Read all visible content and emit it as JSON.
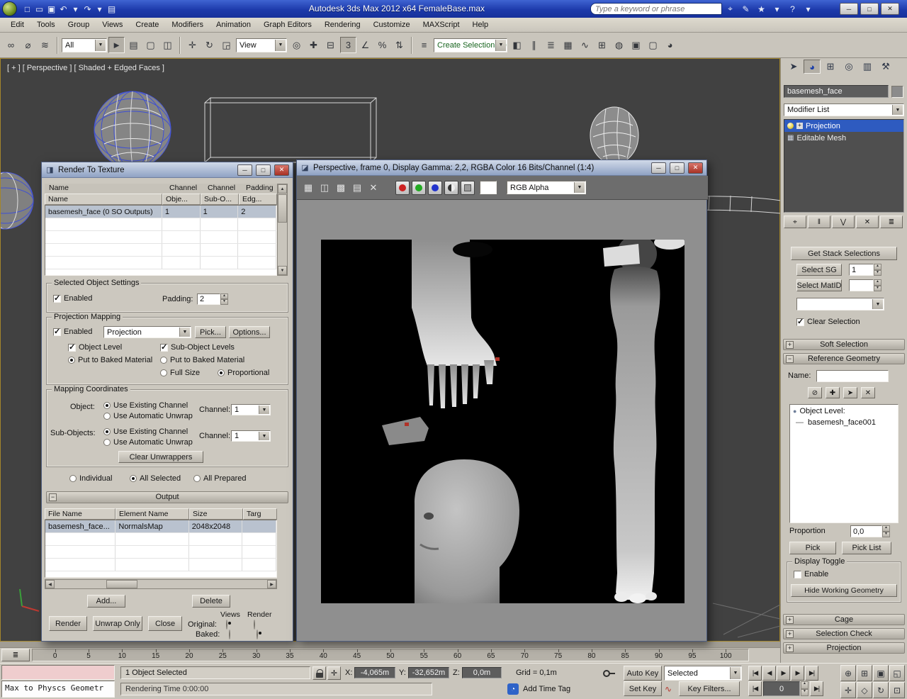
{
  "window_controls": {
    "minimize": "─",
    "maximize": "□",
    "close": "✕"
  },
  "titlebar": {
    "title": "Autodesk 3ds Max 2012 x64   FemaleBase.max",
    "search_placeholder": "Type a keyword or phrase",
    "qat_icons": [
      {
        "name": "new-file-icon",
        "glyph": "□"
      },
      {
        "name": "open-file-icon",
        "glyph": "▭"
      },
      {
        "name": "save-file-icon",
        "glyph": "▣"
      },
      {
        "name": "undo-icon",
        "glyph": "↶"
      },
      {
        "name": "undo-dropdown-icon",
        "glyph": "▾"
      },
      {
        "name": "redo-icon",
        "glyph": "↷"
      },
      {
        "name": "redo-dropdown-icon",
        "glyph": "▾"
      },
      {
        "name": "project-toolbar-icon",
        "glyph": "▤"
      }
    ],
    "infocenter_icons": [
      {
        "name": "search-icon",
        "glyph": "⌖"
      },
      {
        "name": "communication-center-icon",
        "glyph": "✎"
      },
      {
        "name": "favorites-icon",
        "glyph": "★"
      },
      {
        "name": "favorites-dropdown-icon",
        "glyph": "▾"
      },
      {
        "name": "help-icon",
        "glyph": "?"
      },
      {
        "name": "help-dropdown-icon",
        "glyph": "▾"
      }
    ]
  },
  "menu": {
    "items": [
      "Edit",
      "Tools",
      "Group",
      "Views",
      "Create",
      "Modifiers",
      "Animation",
      "Graph Editors",
      "Rendering",
      "Customize",
      "MAXScript",
      "Help"
    ]
  },
  "toolbar": {
    "selection_filter": "All",
    "coordinate_system": "View",
    "named_selection": "Create Selection Se",
    "group1": [
      {
        "name": "select-and-link-icon",
        "glyph": "∞"
      },
      {
        "name": "unlink-selection-icon",
        "glyph": "⌀"
      },
      {
        "name": "bind-to-space-warp-icon",
        "glyph": "≋"
      }
    ],
    "group2": [
      {
        "name": "select-object-icon",
        "glyph": "►"
      },
      {
        "name": "select-by-name-icon",
        "glyph": "▤"
      },
      {
        "name": "rectangular-selection-icon",
        "glyph": "▢"
      },
      {
        "name": "window-crossing-icon",
        "glyph": "◫"
      }
    ],
    "group3": [
      {
        "name": "select-and-move-icon",
        "glyph": "✛"
      },
      {
        "name": "select-and-rotate-icon",
        "glyph": "↻"
      },
      {
        "name": "select-and-scale-icon",
        "glyph": "◲"
      }
    ],
    "group4": [
      {
        "name": "use-center-icon",
        "glyph": "◎"
      },
      {
        "name": "select-and-manipulate-icon",
        "glyph": "✚"
      },
      {
        "name": "keyboard-override-icon",
        "glyph": "⊟"
      }
    ],
    "group5": [
      {
        "name": "snaps-toggle-icon",
        "glyph": "3"
      },
      {
        "name": "angle-snap-icon",
        "glyph": "∠"
      },
      {
        "name": "percent-snap-icon",
        "glyph": "%"
      },
      {
        "name": "spinner-snap-icon",
        "glyph": "⇅"
      }
    ],
    "group6": [
      {
        "name": "edit-named-selections-icon",
        "glyph": "≡"
      }
    ],
    "group7": [
      {
        "name": "mirror-icon",
        "glyph": "◧"
      },
      {
        "name": "align-icon",
        "glyph": "∥"
      },
      {
        "name": "layer-manager-icon",
        "glyph": "≣"
      },
      {
        "name": "ribbon-toggle-icon",
        "glyph": "▦"
      },
      {
        "name": "curve-editor-icon",
        "glyph": "∿"
      },
      {
        "name": "schematic-view-icon",
        "glyph": "⊞"
      },
      {
        "name": "material-editor-icon",
        "glyph": "◍"
      },
      {
        "name": "render-setup-icon",
        "glyph": "▣"
      },
      {
        "name": "rendered-frame-icon",
        "glyph": "▢"
      },
      {
        "name": "render-production-icon",
        "glyph": "◕"
      }
    ]
  },
  "viewport": {
    "label": "[ + ] [ Perspective ] [ Shaded + Edged Faces ]"
  },
  "rtt": {
    "title": "Render To Texture",
    "objects_table": {
      "header_row1": [
        "Name",
        "Channel",
        "Channel",
        "Padding"
      ],
      "header_row2": [
        "Name",
        "Obje...",
        "Sub-O...",
        "Edg..."
      ],
      "row_name": "basemesh_face (0 SO Outputs)",
      "row_values": [
        "1",
        "1",
        "2"
      ]
    },
    "sos": {
      "title": "Selected Object Settings",
      "enabled": "Enabled",
      "padding_label": "Padding:",
      "padding_value": "2"
    },
    "pm": {
      "title": "Projection Mapping",
      "enabled": "Enabled",
      "modifier": "Projection",
      "pick": "Pick...",
      "options": "Options...",
      "object_level": "Object Level",
      "sub_object_levels": "Sub-Object Levels",
      "put_baked_1": "Put to Baked Material",
      "put_baked_2": "Put to Baked Material",
      "full_size": "Full Size",
      "proportional": "Proportional"
    },
    "mc": {
      "title": "Mapping Coordinates",
      "object": "Object:",
      "sub_objects": "Sub-Objects:",
      "use_existing_1": "Use Existing Channel",
      "use_auto_1": "Use Automatic Unwrap",
      "use_existing_2": "Use Existing Channel",
      "use_auto_2": "Use Automatic Unwrap",
      "channel_label_1": "Channel:",
      "channel_value_1": "1",
      "channel_label_2": "Channel:",
      "channel_value_2": "1",
      "clear_unwrappers": "Clear Unwrappers"
    },
    "scope": {
      "individual": "Individual",
      "all_selected": "All Selected",
      "all_prepared": "All Prepared"
    },
    "output": {
      "title": "Output",
      "headers": [
        "File Name",
        "Element Name",
        "Size",
        "Targ"
      ],
      "row": [
        "basemesh_face...",
        "NormalsMap",
        "2048x2048"
      ],
      "add": "Add...",
      "delete": "Delete",
      "views": "Views",
      "render": "Render",
      "original": "Original:",
      "baked": "Baked:"
    },
    "buttons": {
      "render": "Render",
      "unwrap_only": "Unwrap Only",
      "close": "Close"
    }
  },
  "rfw": {
    "title": "Perspective, frame 0, Display Gamma: 2,2, RGBA Color 16 Bits/Channel (1:4)",
    "channel_value": "RGB Alpha",
    "toolbar_icons": [
      {
        "name": "save-image-icon",
        "glyph": "▦"
      },
      {
        "name": "clone-rendered-frame-icon",
        "glyph": "◫"
      },
      {
        "name": "enable-channels-icon",
        "glyph": "▩"
      },
      {
        "name": "print-image-icon",
        "glyph": "▤"
      },
      {
        "name": "clear-rendered-frame-icon",
        "glyph": "✕"
      }
    ]
  },
  "command_panel": {
    "tabs": [
      {
        "name": "tab-create",
        "glyph": "➤"
      },
      {
        "name": "tab-modify",
        "glyph": "◕"
      },
      {
        "name": "tab-hierarchy",
        "glyph": "⊞"
      },
      {
        "name": "tab-motion",
        "glyph": "◎"
      },
      {
        "name": "tab-display",
        "glyph": "▥"
      },
      {
        "name": "tab-utilities",
        "glyph": "⚒"
      }
    ],
    "object_name": "basemesh_face",
    "modifier_list_label": "Modifier List",
    "stack_item_1": "Projection",
    "stack_item_2": "Editable Mesh",
    "expand_glyph": "+",
    "mesh_glyph": "▦",
    "stack_tools": [
      {
        "name": "pin-stack-icon",
        "glyph": "⌖"
      },
      {
        "name": "show-end-result-icon",
        "glyph": "‖"
      },
      {
        "name": "make-unique-icon",
        "glyph": "⋁"
      },
      {
        "name": "remove-modifier-icon",
        "glyph": "✕"
      },
      {
        "name": "configure-modifier-sets-icon",
        "glyph": "≣"
      }
    ],
    "get_stack_selections": "Get Stack Selections",
    "select_sg": "Select SG",
    "select_sg_value": "1",
    "select_matid": "Select MatID",
    "select_matid_value": "",
    "clear_selection": "Clear Selection",
    "soft_selection": "Soft Selection",
    "reference_geometry": "Reference Geometry",
    "name_label": "Name:",
    "ref_icons": [
      {
        "name": "remove-reference-icon",
        "glyph": "⊘"
      },
      {
        "name": "add-reference-icon",
        "glyph": "✚"
      },
      {
        "name": "pick-reference-icon",
        "glyph": "➤"
      },
      {
        "name": "delete-reference-icon",
        "glyph": "✕"
      }
    ],
    "list_header": "Object Level:",
    "list_dash": "—",
    "list_item": "basemesh_face001",
    "sphere_glyph": "●",
    "proportion_label": "Proportion",
    "proportion_value": "0,0",
    "pick": "Pick",
    "pick_list": "Pick List",
    "display_toggle": "Display Toggle",
    "enable_label": "Enable",
    "hide_working_geometry": "Hide Working Geometry",
    "cage": "Cage",
    "selection_check": "Selection Check",
    "projection": "Projection"
  },
  "timeline": {
    "ticks": [
      "0",
      "5",
      "10",
      "15",
      "20",
      "25",
      "30",
      "35",
      "40",
      "45",
      "50",
      "55",
      "60",
      "65",
      "70",
      "75",
      "80",
      "85",
      "90",
      "95",
      "100"
    ]
  },
  "statusbar": {
    "listener_text": "Max to Physcs Geometr",
    "selection_status": "1 Object Selected",
    "prompt": "Rendering Time  0:00:00",
    "x_label": "X:",
    "x_value": "-4,065m",
    "y_label": "Y:",
    "y_value": "-32,652m",
    "z_label": "Z:",
    "z_value": "0,0m",
    "grid_text": "Grid = 0,1m",
    "add_time_tag": "Add Time Tag",
    "auto_key": "Auto Key",
    "set_key": "Set Key",
    "key_mode": "Selected",
    "key_filters": "Key Filters...",
    "frame_value": "0",
    "playback_icons": [
      {
        "name": "go-to-start-icon",
        "glyph": "|◀"
      },
      {
        "name": "previous-frame-icon",
        "glyph": "◀"
      },
      {
        "name": "play-icon",
        "glyph": "▶"
      },
      {
        "name": "next-frame-icon",
        "glyph": "▶"
      },
      {
        "name": "go-to-end-icon",
        "glyph": "▶|"
      }
    ],
    "nav_icons_row1": [
      {
        "name": "zoom-icon",
        "glyph": "⊕"
      },
      {
        "name": "zoom-all-icon",
        "glyph": "⊞"
      },
      {
        "name": "zoom-extents-icon",
        "glyph": "▣"
      },
      {
        "name": "zoom-region-icon",
        "glyph": "◱"
      }
    ],
    "nav_icons_row2": [
      {
        "name": "pan-icon",
        "glyph": "✛"
      },
      {
        "name": "field-of-view-icon",
        "glyph": "◇"
      },
      {
        "name": "orbit-icon",
        "glyph": "↻"
      },
      {
        "name": "maximize-viewport-icon",
        "glyph": "⊡"
      }
    ]
  }
}
